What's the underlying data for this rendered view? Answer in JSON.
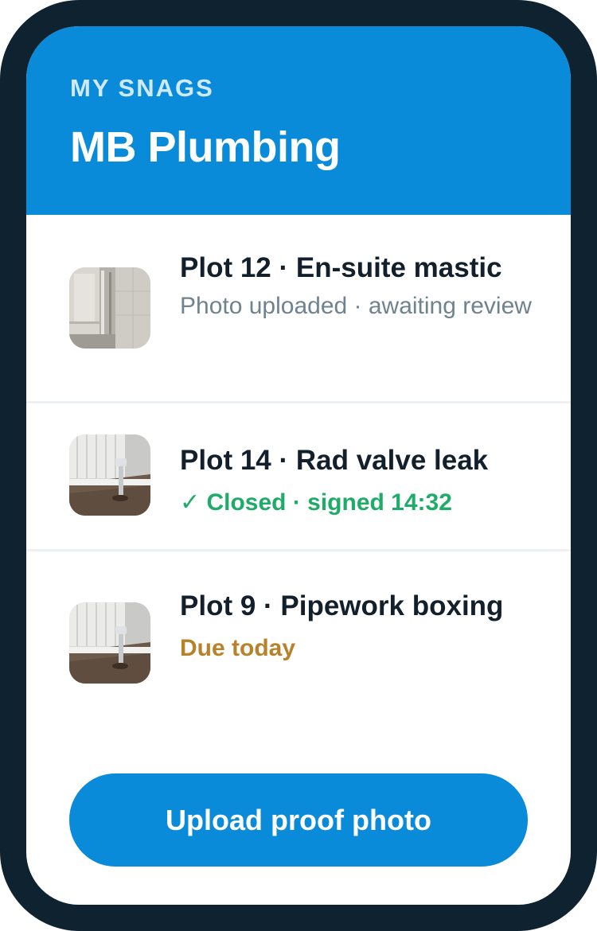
{
  "header": {
    "eyebrow": "MY SNAGS",
    "title": "MB Plumbing"
  },
  "snags": [
    {
      "title": "Plot 12 · En-suite mastic",
      "status": "Photo uploaded · awaiting review",
      "status_kind": "muted",
      "thumbnail": "shower-photo"
    },
    {
      "title": "Plot 14 · Rad valve leak",
      "status": "✓ Closed · signed 14:32",
      "status_kind": "closed",
      "thumbnail": "radiator-valve-photo"
    },
    {
      "title": "Plot 9 · Pipework boxing",
      "status": "Due today",
      "status_kind": "due",
      "thumbnail": "radiator-valve-photo"
    }
  ],
  "cta": {
    "label": "Upload proof photo"
  },
  "colors": {
    "frame": "#0f2230",
    "brand": "#0a8bd9",
    "eyebrow": "#cfeaff",
    "closed": "#1fab68",
    "due": "#b8822a",
    "muted": "#6f8290"
  }
}
